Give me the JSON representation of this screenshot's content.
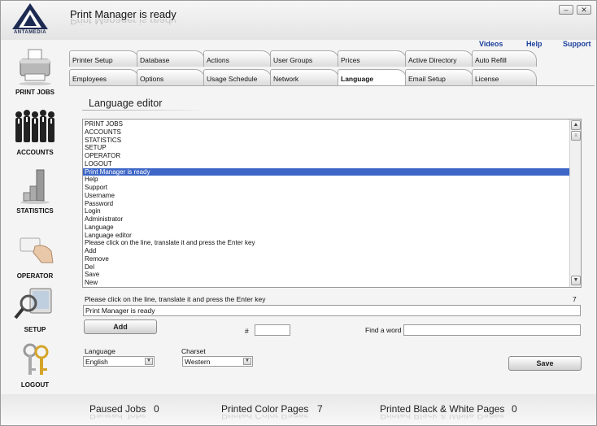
{
  "app": {
    "brand": "ANTAMEDIA",
    "title": "Print Manager is ready",
    "minimize_icon": "minimize-icon",
    "close_icon": "close-icon"
  },
  "top_links": {
    "videos": "Videos",
    "help": "Help",
    "support": "Support"
  },
  "sidebar": {
    "items": [
      {
        "label": "PRINT JOBS",
        "icon": "printer-icon"
      },
      {
        "label": "ACCOUNTS",
        "icon": "people-icon"
      },
      {
        "label": "STATISTICS",
        "icon": "bar-chart-icon"
      },
      {
        "label": "OPERATOR",
        "icon": "card-hand-icon"
      },
      {
        "label": "SETUP",
        "icon": "magnifier-monitor-icon"
      },
      {
        "label": "LOGOUT",
        "icon": "keys-icon"
      }
    ]
  },
  "tabs": {
    "row1": [
      "Printer Setup",
      "Database",
      "Actions",
      "User Groups",
      "Prices",
      "Active Directory",
      "Auto Refill"
    ],
    "row2": [
      "Employees",
      "Options",
      "Usage Schedule",
      "Network",
      "Language",
      "Email Setup",
      "License"
    ],
    "active": "Language"
  },
  "editor": {
    "section_title": "Language editor",
    "list_items": [
      "PRINT JOBS",
      "ACCOUNTS",
      "STATISTICS",
      "SETUP",
      "OPERATOR",
      "LOGOUT",
      "Print Manager is ready",
      "Help",
      "Support",
      "Username",
      "Password",
      "Login",
      "Administrator",
      "Language",
      "Language editor",
      "Please click on the line, translate it and press the Enter key",
      "Add",
      "Remove",
      "Del",
      "Save",
      "New"
    ],
    "selected_index": 6,
    "instruction": "Please click on the line, translate it and press the Enter key",
    "line_number": "7",
    "edit_value": "Print Manager is ready",
    "add_button": "Add",
    "number_label": "#",
    "number_value": "",
    "find_label": "Find a word",
    "find_value": "",
    "language_label": "Language",
    "language_value": "English",
    "charset_label": "Charset",
    "charset_value": "Western",
    "save_button": "Save"
  },
  "status": {
    "paused_label": "Paused Jobs",
    "paused_value": "0",
    "color_label": "Printed Color Pages",
    "color_value": "7",
    "bw_label": "Printed Black & White Pages",
    "bw_value": "0"
  },
  "colors": {
    "selection": "#3d66c6",
    "link": "#1b3f9c"
  }
}
